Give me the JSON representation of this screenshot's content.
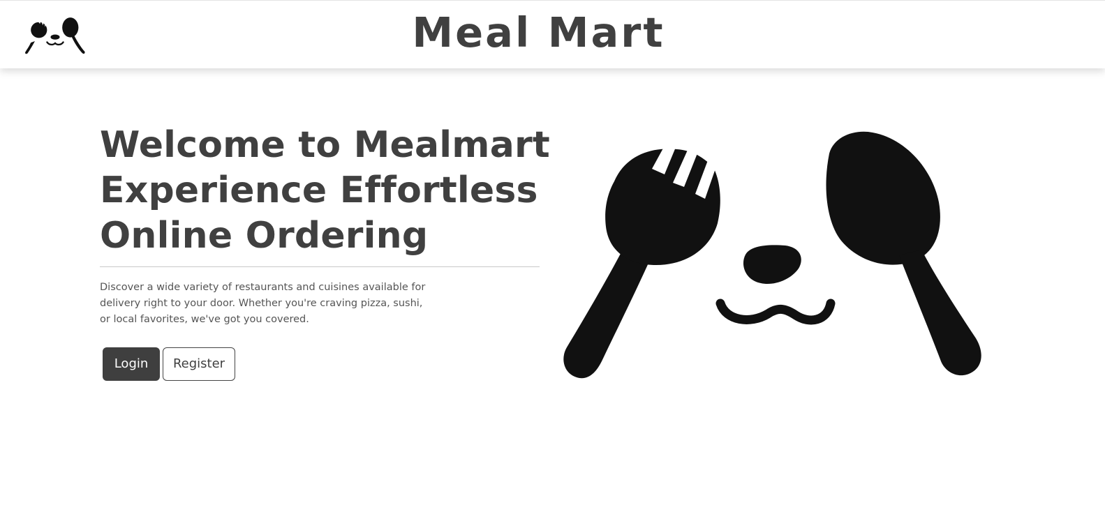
{
  "header": {
    "logo_icon": "panda-utensils-logo-icon",
    "title": "Meal Mart"
  },
  "hero": {
    "title_lines": [
      "Welcome to Mealmart",
      "Experience Effortless",
      "Online Ordering"
    ],
    "description": "Discover a wide variety of restaurants and cuisines available for delivery right to your door. Whether you're craving pizza, sushi, or local favorites, we've got you covered.",
    "illustration_icon": "panda-utensils-illustration"
  },
  "actions": {
    "login_label": "Login",
    "register_label": "Register"
  },
  "colors": {
    "text": "#404040",
    "primary_button": "#3f3f3f",
    "illustration": "#111111"
  }
}
